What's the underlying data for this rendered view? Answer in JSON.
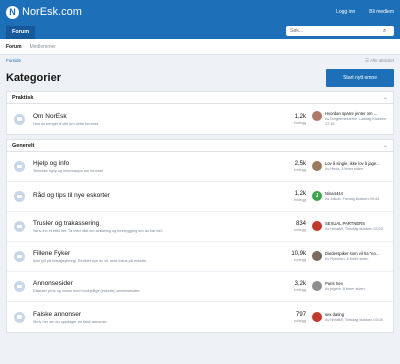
{
  "header": {
    "logo_text": "NorEsk.com",
    "login": "Logg inn",
    "register": "Bli medlem"
  },
  "nav": {
    "tab_forum": "Forum",
    "search_placeholder": "Søk..."
  },
  "subnav": {
    "forum": "Forum",
    "members": "Medlemmer"
  },
  "breadcrumb": {
    "home": "Forside",
    "all_activity": "Alle aktivitet"
  },
  "page": {
    "title": "Kategorier",
    "new_topic": "Start nytt emne"
  },
  "colors": {
    "accent": "#1d6fb7"
  },
  "sections": [
    {
      "name": "Praktisk",
      "forums": [
        {
          "title": "Om NorEsk",
          "desc": "Hva du trenger å vite om dette forumet.",
          "count": "1,2k",
          "count_label": "innlegg",
          "last_title": "Hvordan sparre jenter om ...",
          "last_meta": "Av borgermesteren, Lørdag Klokken 17:18",
          "avatar_letter": "",
          "avatar_color": "#b0786b"
        }
      ]
    },
    {
      "name": "Generelt",
      "forums": [
        {
          "title": "Hjelp og info",
          "desc": "Tekniske hjelp og informasjon om forumet",
          "count": "2,5k",
          "count_label": "innlegg",
          "last_title": "Lov å single, ikke lov å jage...",
          "last_meta": "Av Hexa, 3 timer siden",
          "avatar_letter": "",
          "avatar_color": "#9a7b5c"
        },
        {
          "title": "Råd og tips til nye eskorter",
          "desc": "",
          "count": "1,2k",
          "count_label": "innlegg",
          "last_title": "Nina4444",
          "last_meta": "Av Jakob, Fredag klokken 09:44",
          "avatar_letter": "J",
          "avatar_color": "#3fa34d"
        },
        {
          "title": "Trusler og trakassering",
          "desc": "Skriv inn et etikt her. Ta med rådt om avsløring og forebygging om du har det.",
          "count": "834",
          "count_label": "innlegg",
          "last_title": "SEXUAL PARTNERS",
          "last_meta": "Av hbhaMl, Torsdag klokken 03:03",
          "avatar_letter": "",
          "avatar_color": "#c0392b"
        },
        {
          "title": "Fillene Fyker",
          "desc": "Ikke fyll på bidragsyteregl. Etotidet nye du vil, med fokus på eskorte.",
          "count": "10,9k",
          "count_label": "innlegg",
          "last_title": "Diederspiker som vil ha \"no...",
          "last_meta": "Av Ryenten, 8 timer siden",
          "avatar_letter": "",
          "avatar_color": "#7d6a58"
        },
        {
          "title": "Annonsesider",
          "desc": "Diskuter jevis og minus med forskjellige (eskorte) annonsesider.",
          "count": "3,2k",
          "count_label": "innlegg",
          "last_title": "Paris Sex",
          "last_meta": "Av jegem, 8 timer siden",
          "avatar_letter": "",
          "avatar_color": "#8e8e8e"
        },
        {
          "title": "Falske annonser",
          "desc": "Skriv her om du oppdager en falsk annonse.",
          "count": "797",
          "count_label": "innlegg",
          "last_title": "sex dating",
          "last_meta": "Av hbhaMl, Torsdag klokken 03:05",
          "avatar_letter": "",
          "avatar_color": "#c0392b"
        }
      ]
    }
  ]
}
